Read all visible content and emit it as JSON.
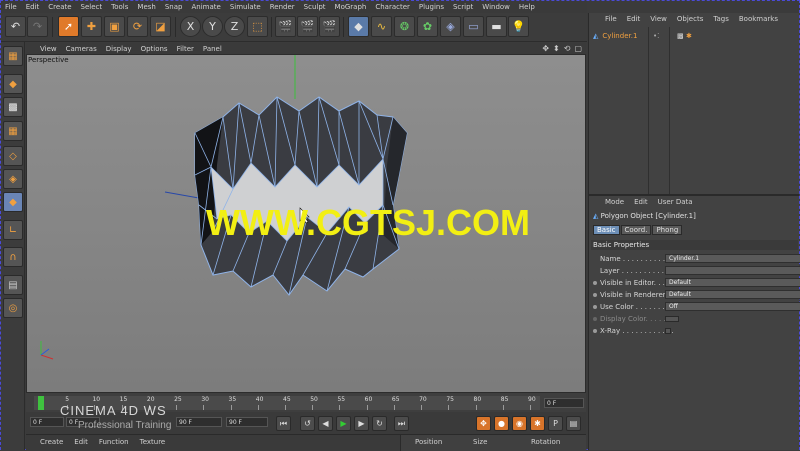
{
  "main_menu": [
    "File",
    "Edit",
    "Create",
    "Select",
    "Tools",
    "Mesh",
    "Snap",
    "Animate",
    "Simulate",
    "Render",
    "Sculpt",
    "MoGraph",
    "Character",
    "Plugins",
    "Script",
    "Window",
    "Help"
  ],
  "toolbar": {
    "axis_x": "X",
    "axis_y": "Y",
    "axis_z": "Z"
  },
  "viewport": {
    "menu": [
      "View",
      "Cameras",
      "Display",
      "Options",
      "Filter",
      "Panel"
    ],
    "label": "Perspective",
    "colors": {
      "mesh_edge": "#8fb3e8",
      "mesh_dark": "#1e1f22",
      "mesh_light": "#cfd0d2"
    }
  },
  "timeline": {
    "ticks": [
      "0",
      "5",
      "10",
      "15",
      "20",
      "25",
      "30",
      "35",
      "40",
      "45",
      "50",
      "55",
      "60",
      "65",
      "70",
      "75",
      "80",
      "85",
      "90"
    ],
    "end_frame": "0 F"
  },
  "transport": {
    "current_frame": "0 F",
    "min_frame": "0 F",
    "range_end": "90 F",
    "max_frame": "90 F"
  },
  "material_menu": [
    "Create",
    "Edit",
    "Function",
    "Texture"
  ],
  "coord_headers": {
    "position": "Position",
    "size": "Size",
    "rotation": "Rotation"
  },
  "watermark": "WWW.CGTSJ.COM",
  "logo": {
    "brand": "CINEMA 4D WS",
    "sub": "Professional Training"
  },
  "object_manager": {
    "menu": [
      "File",
      "Edit",
      "View",
      "Objects",
      "Tags",
      "Bookmarks"
    ],
    "object_name": "Cylinder.1"
  },
  "attribute_manager": {
    "menu": [
      "Mode",
      "Edit",
      "User Data"
    ],
    "title": "Polygon Object [Cylinder.1]",
    "tabs": [
      "Basic",
      "Coord.",
      "Phong"
    ],
    "section": "Basic Properties",
    "props": [
      {
        "label": "Name . . . . . . . . . . . . .",
        "value": "Cylinder.1"
      },
      {
        "label": "Layer . . . . . . . . . . . . .",
        "value": ""
      },
      {
        "label": "Visible in Editor. . . .",
        "value": "Default"
      },
      {
        "label": "Visible in Renderer",
        "value": "Default"
      },
      {
        "label": "Use Color . . . . . . . . .",
        "value": "Off"
      },
      {
        "label": "Display Color. . . . . .",
        "value": ""
      },
      {
        "label": "X-Ray . . . . . . . . . . . .",
        "value": ""
      }
    ]
  }
}
